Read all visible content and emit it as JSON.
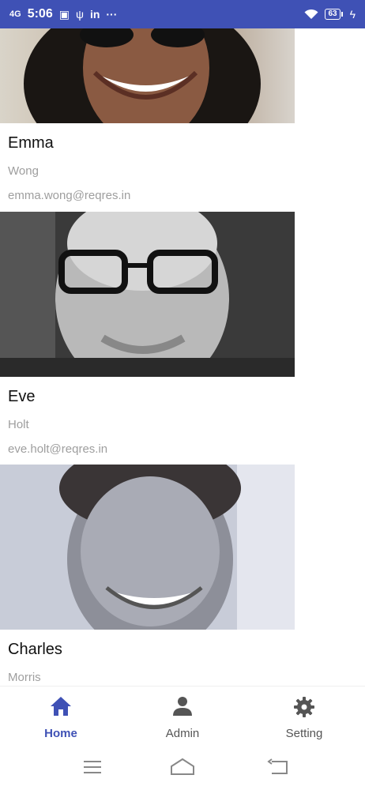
{
  "status_bar": {
    "time": "5:06",
    "network": "4G",
    "linkedin": "in",
    "more": "···",
    "battery": "63",
    "icons": [
      "signal-icon",
      "sim-icon",
      "usb-icon",
      "wifi-icon",
      "battery-icon",
      "charging-icon"
    ]
  },
  "users": [
    {
      "first_name": "Emma",
      "last_name": "Wong",
      "email": "emma.wong@reqres.in"
    },
    {
      "first_name": "Eve",
      "last_name": "Holt",
      "email": "eve.holt@reqres.in"
    },
    {
      "first_name": "Charles",
      "last_name": "Morris",
      "email": ""
    }
  ],
  "bottom_nav": {
    "items": [
      {
        "label": "Home",
        "icon": "home-icon",
        "active": true
      },
      {
        "label": "Admin",
        "icon": "person-icon",
        "active": false
      },
      {
        "label": "Setting",
        "icon": "gear-icon",
        "active": false
      }
    ],
    "active_color": "#3f51b5",
    "inactive_color": "#555555"
  },
  "colors": {
    "status_bar": "#3f51b5",
    "secondary_text": "#9e9e9e"
  }
}
